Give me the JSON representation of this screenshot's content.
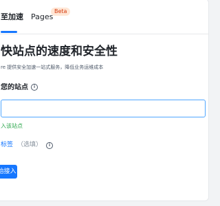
{
  "tabs": [
    {
      "label": "至加速",
      "active": true
    },
    {
      "label": "Pages",
      "badge": "Beta"
    }
  ],
  "main": {
    "title": "快站点的速度和安全性",
    "subtitle": "re 提供安全加速一站式服务，降低业务运维成本",
    "site_label": "您的站点",
    "site_input_value": "",
    "site_hint": "入该站点",
    "tags_label": "标签",
    "tags_optional": "（选填）",
    "submit_label": "始接入"
  },
  "icons": {
    "site_info": "info-icon",
    "tags_info": "info-icon"
  },
  "colors": {
    "accent": "#1677ff",
    "success": "#2fa84f",
    "badge_bg": "#ffe7d6",
    "badge_text": "#d4380d"
  }
}
